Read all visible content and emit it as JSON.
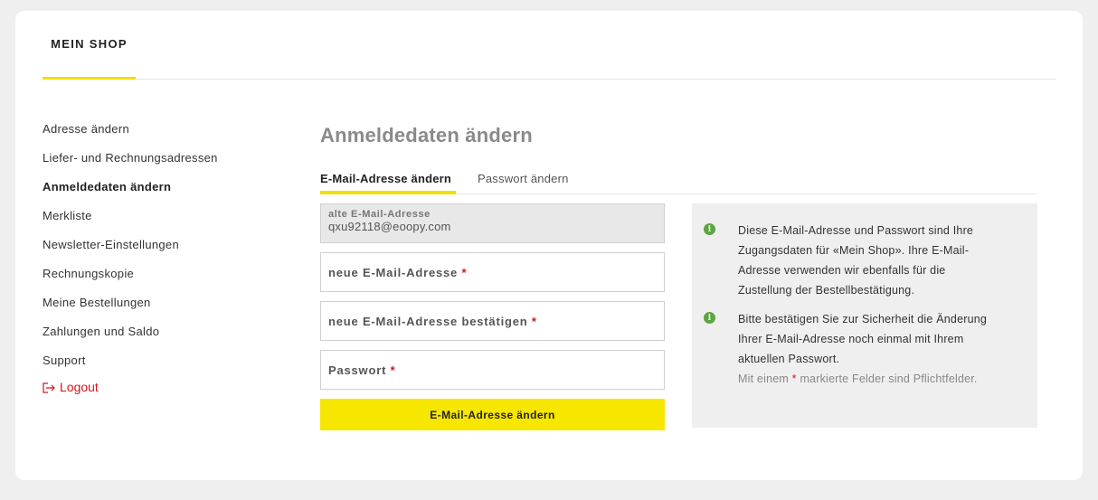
{
  "header": {
    "tab_label": "MEIN SHOP"
  },
  "sidebar": {
    "items": [
      {
        "label": "Adresse ändern"
      },
      {
        "label": "Liefer- und Rechnungsadressen"
      },
      {
        "label": "Anmeldedaten ändern"
      },
      {
        "label": "Merkliste"
      },
      {
        "label": "Newsletter-Einstellungen"
      },
      {
        "label": "Rechnungskopie"
      },
      {
        "label": "Meine Bestellungen"
      },
      {
        "label": "Zahlungen und Saldo"
      },
      {
        "label": "Support"
      }
    ],
    "logout_label": "Logout",
    "logout_icon": "logout-arrow-icon"
  },
  "main": {
    "title": "Anmeldedaten ändern",
    "tabs": [
      {
        "label": "E-Mail-Adresse ändern"
      },
      {
        "label": "Passwort ändern"
      }
    ],
    "form": {
      "old_email_label": "alte E-Mail-Adresse",
      "old_email_value": "qxu92118@eoopy.com",
      "new_email_label": "neue E-Mail-Adresse",
      "confirm_email_label": "neue E-Mail-Adresse bestätigen",
      "password_label": "Passwort",
      "required_marker": "*",
      "submit_label": "E-Mail-Adresse ändern"
    },
    "info": {
      "icon": "info-icon",
      "paragraph_1": "Diese E-Mail-Adresse und Passwort sind Ihre Zugangsdaten für «Mein Shop». Ihre E-Mail-Adresse verwenden wir ebenfalls für die Zustellung der Bestellbestätigung.",
      "paragraph_2": "Bitte bestätigen Sie zur Sicherheit die Änderung Ihrer E-Mail-Adresse noch einmal mit Ihrem aktuellen Passwort.",
      "required_note_prefix": "Mit einem",
      "required_note_marker": "*",
      "required_note_suffix": "markierte Felder sind Pflichtfelder."
    }
  },
  "colors": {
    "accent_yellow": "#f6e600",
    "required_red": "#d3151d",
    "info_green": "#5ca540"
  }
}
